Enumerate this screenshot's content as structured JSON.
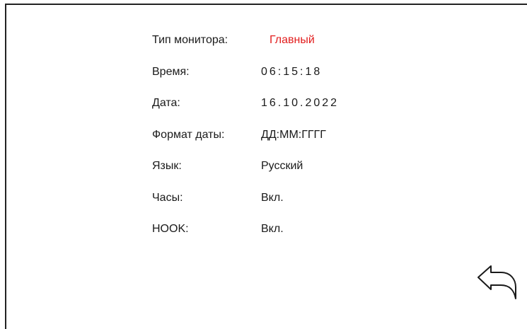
{
  "colors": {
    "accent": "#e21e1e",
    "text": "#1a1a1a",
    "frame": "#222222"
  },
  "settings": [
    {
      "label": "Тип монитора:",
      "value": "Главный",
      "accent": true,
      "spaced": false
    },
    {
      "label": "Время:",
      "value": "06:15:18",
      "accent": false,
      "spaced": true
    },
    {
      "label": "Дата:",
      "value": "16.10.2022",
      "accent": false,
      "spaced": true
    },
    {
      "label": "Формат даты:",
      "value": "ДД:ММ:ГГГГ",
      "accent": false,
      "spaced": false
    },
    {
      "label": "Язык:",
      "value": "Русский",
      "accent": false,
      "spaced": false
    },
    {
      "label": "Часы:",
      "value": "Вкл.",
      "accent": false,
      "spaced": false
    },
    {
      "label": "HOOK:",
      "value": "Вкл.",
      "accent": false,
      "spaced": false
    }
  ],
  "back_button": {
    "icon": "back-arrow-icon"
  }
}
